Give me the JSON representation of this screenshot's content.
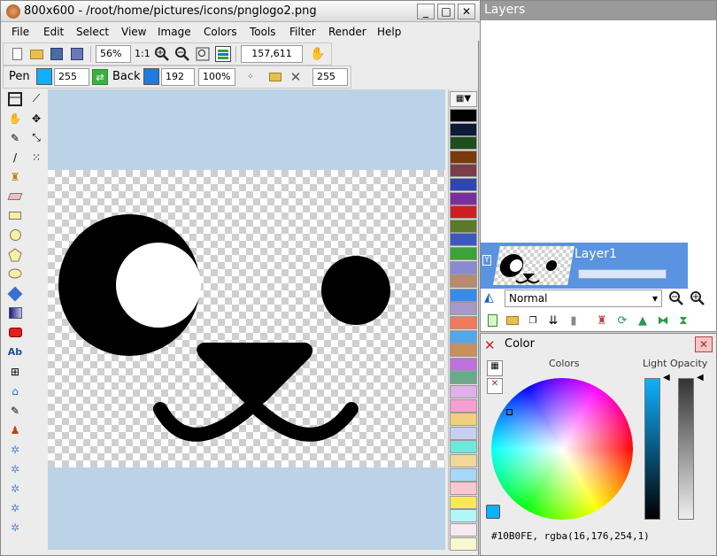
{
  "window": {
    "title": "800x600 - /root/home/pictures/icons/pnglogo2.png",
    "min": "_",
    "max": "□",
    "close": "✕"
  },
  "menu": [
    "File",
    "Edit",
    "Select",
    "View",
    "Image",
    "Colors",
    "Tools",
    "Filter",
    "Render",
    "Help"
  ],
  "toolbar1": {
    "zoom": "56%",
    "ratio": "1:1",
    "coords": "157,611"
  },
  "toolbar2": {
    "pen_label": "Pen",
    "pen_value": "255",
    "back_label": "Back",
    "back_value": "192",
    "percent": "100%",
    "alpha_value": "255",
    "pen_color": "#10B0FE",
    "back_color": "#1E7BE0"
  },
  "palette": [
    "#000000",
    "#0d1b3a",
    "#1e4d1e",
    "#7a3b0a",
    "#7b3d4b",
    "#2e47b0",
    "#7a2fa0",
    "#cc2020",
    "#5a7a2a",
    "#3a5abf",
    "#3aa33a",
    "#8a8ad0",
    "#b88a70",
    "#3a8ae8",
    "#a898c8",
    "#f07a5a",
    "#50a8e8",
    "#c8905a",
    "#c070e0",
    "#6aaa8a",
    "#e0b0e8",
    "#f5a0d0",
    "#f0d07a",
    "#c8d0f0",
    "#70e8d8",
    "#f0d898",
    "#a8d8f8",
    "#f8c8d0",
    "#f8e858",
    "#b0f8f8",
    "#f8e8f0",
    "#f8f8d0"
  ],
  "layers": {
    "title": "Layers",
    "layer_name": "Layer1",
    "visible_mark": "Y",
    "blend_mode": "Normal"
  },
  "color": {
    "title": "Color",
    "colors_label": "Colors",
    "light_label": "Light",
    "opacity_label": "Opacity",
    "value_text": "#10B0FE, rgba(16,176,254,1)"
  }
}
